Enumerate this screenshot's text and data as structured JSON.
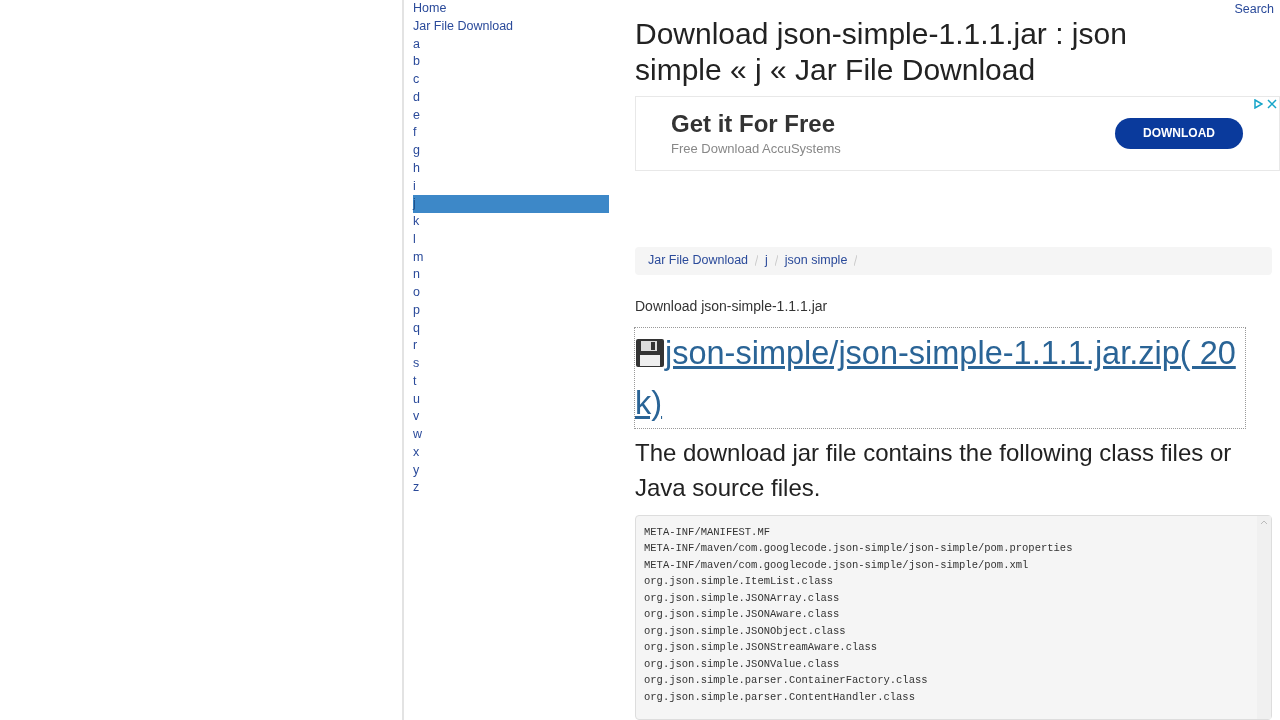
{
  "sidebar": {
    "items": [
      {
        "label": "Home",
        "selected": false
      },
      {
        "label": "Jar File Download",
        "selected": false
      },
      {
        "label": "a",
        "selected": false
      },
      {
        "label": "b",
        "selected": false
      },
      {
        "label": "c",
        "selected": false
      },
      {
        "label": "d",
        "selected": false
      },
      {
        "label": "e",
        "selected": false
      },
      {
        "label": "f",
        "selected": false
      },
      {
        "label": "g",
        "selected": false
      },
      {
        "label": "h",
        "selected": false
      },
      {
        "label": "i",
        "selected": false
      },
      {
        "label": "j",
        "selected": true
      },
      {
        "label": "k",
        "selected": false
      },
      {
        "label": "l",
        "selected": false
      },
      {
        "label": "m",
        "selected": false
      },
      {
        "label": "n",
        "selected": false
      },
      {
        "label": "o",
        "selected": false
      },
      {
        "label": "p",
        "selected": false
      },
      {
        "label": "q",
        "selected": false
      },
      {
        "label": "r",
        "selected": false
      },
      {
        "label": "s",
        "selected": false
      },
      {
        "label": "t",
        "selected": false
      },
      {
        "label": "u",
        "selected": false
      },
      {
        "label": "v",
        "selected": false
      },
      {
        "label": "w",
        "selected": false
      },
      {
        "label": "x",
        "selected": false
      },
      {
        "label": "y",
        "selected": false
      },
      {
        "label": "z",
        "selected": false
      }
    ]
  },
  "search_link": "Search",
  "title": "Download json-simple-1.1.1.jar : json simple « j « Jar File Download",
  "ad": {
    "headline": "Get it For Free",
    "subline": "Free Download AccuSystems",
    "button": "DOWNLOAD"
  },
  "breadcrumb": [
    "Jar File Download",
    "j",
    "json simple"
  ],
  "subtitle": "Download json-simple-1.1.1.jar",
  "download_link": "json-simple/json-simple-1.1.1.jar.zip( 20 k)",
  "description": "The download jar file contains the following class files or Java source files.",
  "files": [
    "META-INF/MANIFEST.MF",
    "META-INF/maven/com.googlecode.json-simple/json-simple/pom.properties",
    "META-INF/maven/com.googlecode.json-simple/json-simple/pom.xml",
    "org.json.simple.ItemList.class",
    "org.json.simple.JSONArray.class",
    "org.json.simple.JSONAware.class",
    "org.json.simple.JSONObject.class",
    "org.json.simple.JSONStreamAware.class",
    "org.json.simple.JSONValue.class",
    "org.json.simple.parser.ContainerFactory.class",
    "org.json.simple.parser.ContentHandler.class"
  ]
}
